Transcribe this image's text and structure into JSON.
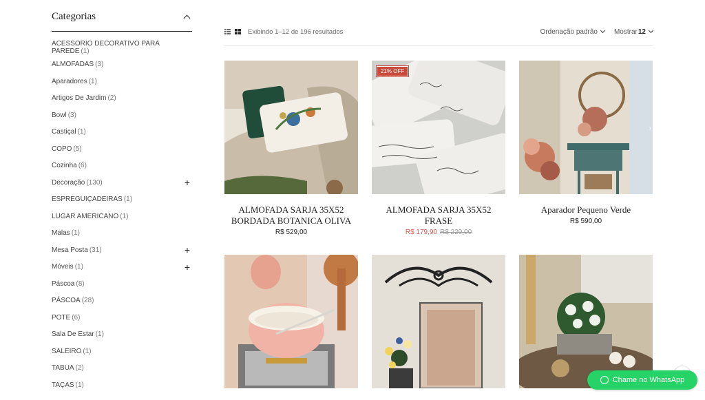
{
  "sidebar": {
    "title": "Categorias",
    "items": [
      {
        "label": "ACESSORIO DECORATIVO PARA PAREDE",
        "count": "(1)",
        "expand": ""
      },
      {
        "label": "ALMOFADAS",
        "count": "(3)",
        "expand": ""
      },
      {
        "label": "Aparadores",
        "count": "(1)",
        "expand": ""
      },
      {
        "label": "Artigos De Jardim",
        "count": "(2)",
        "expand": ""
      },
      {
        "label": "Bowl",
        "count": "(3)",
        "expand": ""
      },
      {
        "label": "Castiçal",
        "count": "(1)",
        "expand": ""
      },
      {
        "label": "COPO",
        "count": "(5)",
        "expand": ""
      },
      {
        "label": "Cozinha",
        "count": "(6)",
        "expand": ""
      },
      {
        "label": "Decoração",
        "count": "(130)",
        "expand": "+"
      },
      {
        "label": "ESPREGUIÇADEIRAS",
        "count": "(1)",
        "expand": ""
      },
      {
        "label": "LUGAR AMERICANO",
        "count": "(1)",
        "expand": ""
      },
      {
        "label": "Malas",
        "count": "(1)",
        "expand": ""
      },
      {
        "label": "Mesa Posta",
        "count": "(31)",
        "expand": "+"
      },
      {
        "label": "Móveis",
        "count": "(1)",
        "expand": "+"
      },
      {
        "label": "Páscoa",
        "count": "(8)",
        "expand": ""
      },
      {
        "label": "PÁSCOA",
        "count": "(28)",
        "expand": ""
      },
      {
        "label": "POTE",
        "count": "(6)",
        "expand": ""
      },
      {
        "label": "Sala De Estar",
        "count": "(1)",
        "expand": ""
      },
      {
        "label": "SALEIRO",
        "count": "(1)",
        "expand": ""
      },
      {
        "label": "TABUA",
        "count": "(2)",
        "expand": ""
      },
      {
        "label": "TAÇAS",
        "count": "(1)",
        "expand": ""
      }
    ]
  },
  "toolbar": {
    "results": "Exibindo 1–12 de 196 resultados",
    "sort_label": "Ordenação padrão",
    "show_label": "Mostrar",
    "show_value": "12"
  },
  "products": [
    {
      "name": "ALMOFADA SARJA 35X52 BORDADA BOTANICA OLIVA",
      "price": "R$ 529,00",
      "old_price": "",
      "badge": ""
    },
    {
      "name": "ALMOFADA SARJA 35X52 FRASE",
      "price": "R$ 179,90",
      "old_price": "R$ 229,00",
      "badge": "21% OFF"
    },
    {
      "name": "Aparador Pequeno Verde",
      "price": "R$ 590,00",
      "old_price": "",
      "badge": ""
    },
    {
      "name": "",
      "price": "",
      "old_price": "",
      "badge": ""
    },
    {
      "name": "",
      "price": "",
      "old_price": "",
      "badge": ""
    },
    {
      "name": "",
      "price": "",
      "old_price": "",
      "badge": ""
    }
  ],
  "whatsapp": {
    "label": "Chame no WhatsApp"
  },
  "colors": {
    "sale": "#d9534f",
    "badge": "#c94a3b",
    "whatsapp": "#25d366"
  }
}
